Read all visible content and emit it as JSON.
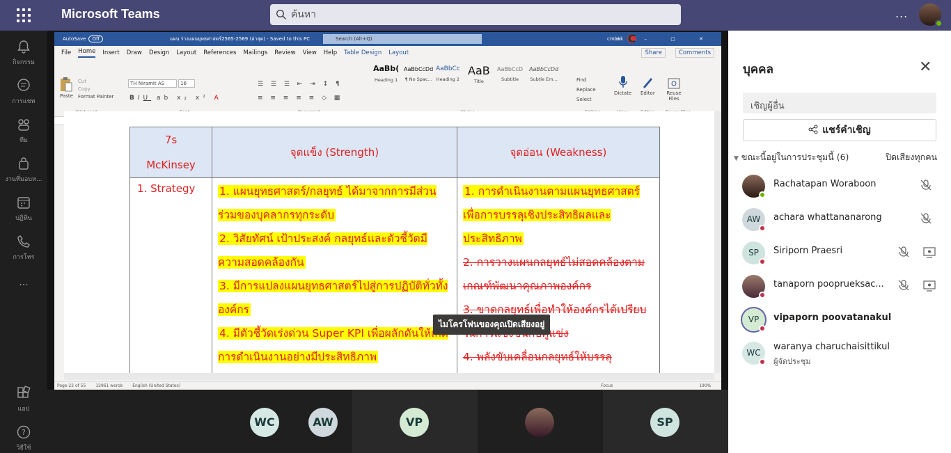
{
  "app": {
    "title": "Microsoft Teams"
  },
  "search": {
    "placeholder": "ค้นหา"
  },
  "header": {
    "more_label": "..."
  },
  "rail": {
    "items": [
      {
        "label": "กิจกรรม",
        "icon": "bell-icon"
      },
      {
        "label": "การแชท",
        "icon": "chat-icon"
      },
      {
        "label": "ทีม",
        "icon": "teams-icon"
      },
      {
        "label": "งานที่มอบห...",
        "icon": "assignments-icon"
      },
      {
        "label": "ปฏิทิน",
        "icon": "calendar-icon"
      },
      {
        "label": "การโทร",
        "icon": "phone-icon"
      },
      {
        "label": "...",
        "icon": "more-icon"
      },
      {
        "label": "แอป",
        "icon": "apps-icon"
      },
      {
        "label": "วิธีใช้",
        "icon": "help-icon"
      }
    ]
  },
  "word": {
    "autosave": "AutoSave",
    "autosave_state": "Off",
    "filename": "แผน ร่างแผนยุทธศาสตร์2565-2569 (ล่าสุด) - Saved to this PC",
    "search_placeholder": "Search (Alt+Q)",
    "user": "cmbkk",
    "user_initial": "C",
    "tabs": [
      "File",
      "Home",
      "Insert",
      "Draw",
      "Design",
      "Layout",
      "References",
      "Mailings",
      "Review",
      "View",
      "Help",
      "Table Design",
      "Layout"
    ],
    "share_label": "Share",
    "comments_label": "Comments",
    "font_name": "TH Niramit AS",
    "font_size": "16",
    "clipboard": {
      "paste": "Paste",
      "cut": "Cut",
      "copy": "Copy",
      "format_painter": "Format Painter"
    },
    "styles": [
      {
        "sample": "AaBb(",
        "name": "Heading 1"
      },
      {
        "sample": "AaBbCcDd",
        "name": "¶ No Spac..."
      },
      {
        "sample": "AaBbCc",
        "name": "Heading 2"
      },
      {
        "sample": "AaB",
        "name": "Title"
      },
      {
        "sample": "AaBbCcD",
        "name": "Subtitle"
      },
      {
        "sample": "AaBbCcDd",
        "name": "Subtle Em..."
      }
    ],
    "editing": {
      "find": "Find",
      "replace": "Replace",
      "select": "Select"
    },
    "dictate": "Dictate",
    "editor": "Editor",
    "reuse_files": "Reuse Files",
    "groups": [
      "Clipboard",
      "Font",
      "Paragraph",
      "Styles",
      "Editing",
      "Voice",
      "Editor",
      "Reuse Files"
    ],
    "status": {
      "page": "Page 22 of 55",
      "words": "12961 words",
      "language": "English (United States)",
      "focus": "Focus",
      "zoom": "190%"
    }
  },
  "table": {
    "headers": [
      "7s\nMcKinsey",
      "จุดแข็ง (Strength)",
      "จุดอ่อน (Weakness)"
    ],
    "row_label": "1. Strategy",
    "strengths": [
      "1. แผนยุทธศาสตร์/กลยุทธ์ ได้มาจากการมีส่วนร่วมของบุคลากรทุกระดับ",
      "2. วิสัยทัศน์ เป้าประสงค์ กลยุทธ์และตัวชี้วัดมีความสอดคล้องกัน",
      "3. มีการแปลงแผนยุทธศาสตร์ไปสู่การปฏิบัติทั่วทั้งองค์กร",
      "4. มีตัวชี้วัดเร่งด่วน Super KPI เพื่อผลักดันให้เกิดการดำเนินงานอย่างมีประสิทธิภาพ"
    ],
    "weaknesses": [
      {
        "text": "1. การดำเนินงานตามแผนยุทธศาสตร์เพื่อการบรรลุเชิงประสิทธิผลและประสิทธิภาพ",
        "struck": false
      },
      {
        "text": "2. การวางแผนกลยุทธ์ไม่สอดคล้องตามเกณฑ์พัฒนาคุณภาพองค์กร",
        "struck": true
      },
      {
        "text": "3. ขาดกลยุทธ์เพื่อทำให้องค์กรได้เปรียบในการแข่งขันกับคู่แข่ง",
        "struck": true
      },
      {
        "text": "4. พลังขับเคลื่อนกลยุทธ์ให้บรรลุ",
        "struck": true
      }
    ]
  },
  "tooltip": "ไมโครโฟนของคุณปิดเสียงอยู่",
  "tiles": [
    {
      "initials": "WC"
    },
    {
      "initials": "AW"
    },
    {
      "initials": "VP"
    },
    {
      "initials": ""
    },
    {
      "initials": "SP"
    }
  ],
  "panel": {
    "title": "บุคคล",
    "invite_placeholder": "เชิญผู้อื่น",
    "share_invite": "แชร์คำเชิญ",
    "in_meeting": "ขณะนี้อยู่ในการประชุมนี้ (6)",
    "mute_all": "ปิดเสียงทุกคน",
    "participants": [
      {
        "name": "Rachatapan Woraboon",
        "initials": "",
        "role": "",
        "badge": "#6bb700",
        "muted": true,
        "sharing": false
      },
      {
        "name": "achara whattananarong",
        "initials": "AW",
        "role": "",
        "badge": "#c4314b",
        "muted": true,
        "sharing": false
      },
      {
        "name": "Siriporn Praesri",
        "initials": "SP",
        "role": "",
        "badge": "#c4314b",
        "muted": true,
        "sharing": true
      },
      {
        "name": "tanaporn pooprueksac...",
        "initials": "",
        "role": "",
        "badge": "#c4314b",
        "muted": true,
        "sharing": true
      },
      {
        "name": "vipaporn poovatanakul",
        "initials": "VP",
        "role": "",
        "badge": "#c4314b",
        "muted": false,
        "sharing": false
      },
      {
        "name": "waranya charuchaisittikul",
        "initials": "WC",
        "role": "ผู้จัดประชุม",
        "badge": "#c4314b",
        "muted": false,
        "sharing": false
      }
    ]
  }
}
